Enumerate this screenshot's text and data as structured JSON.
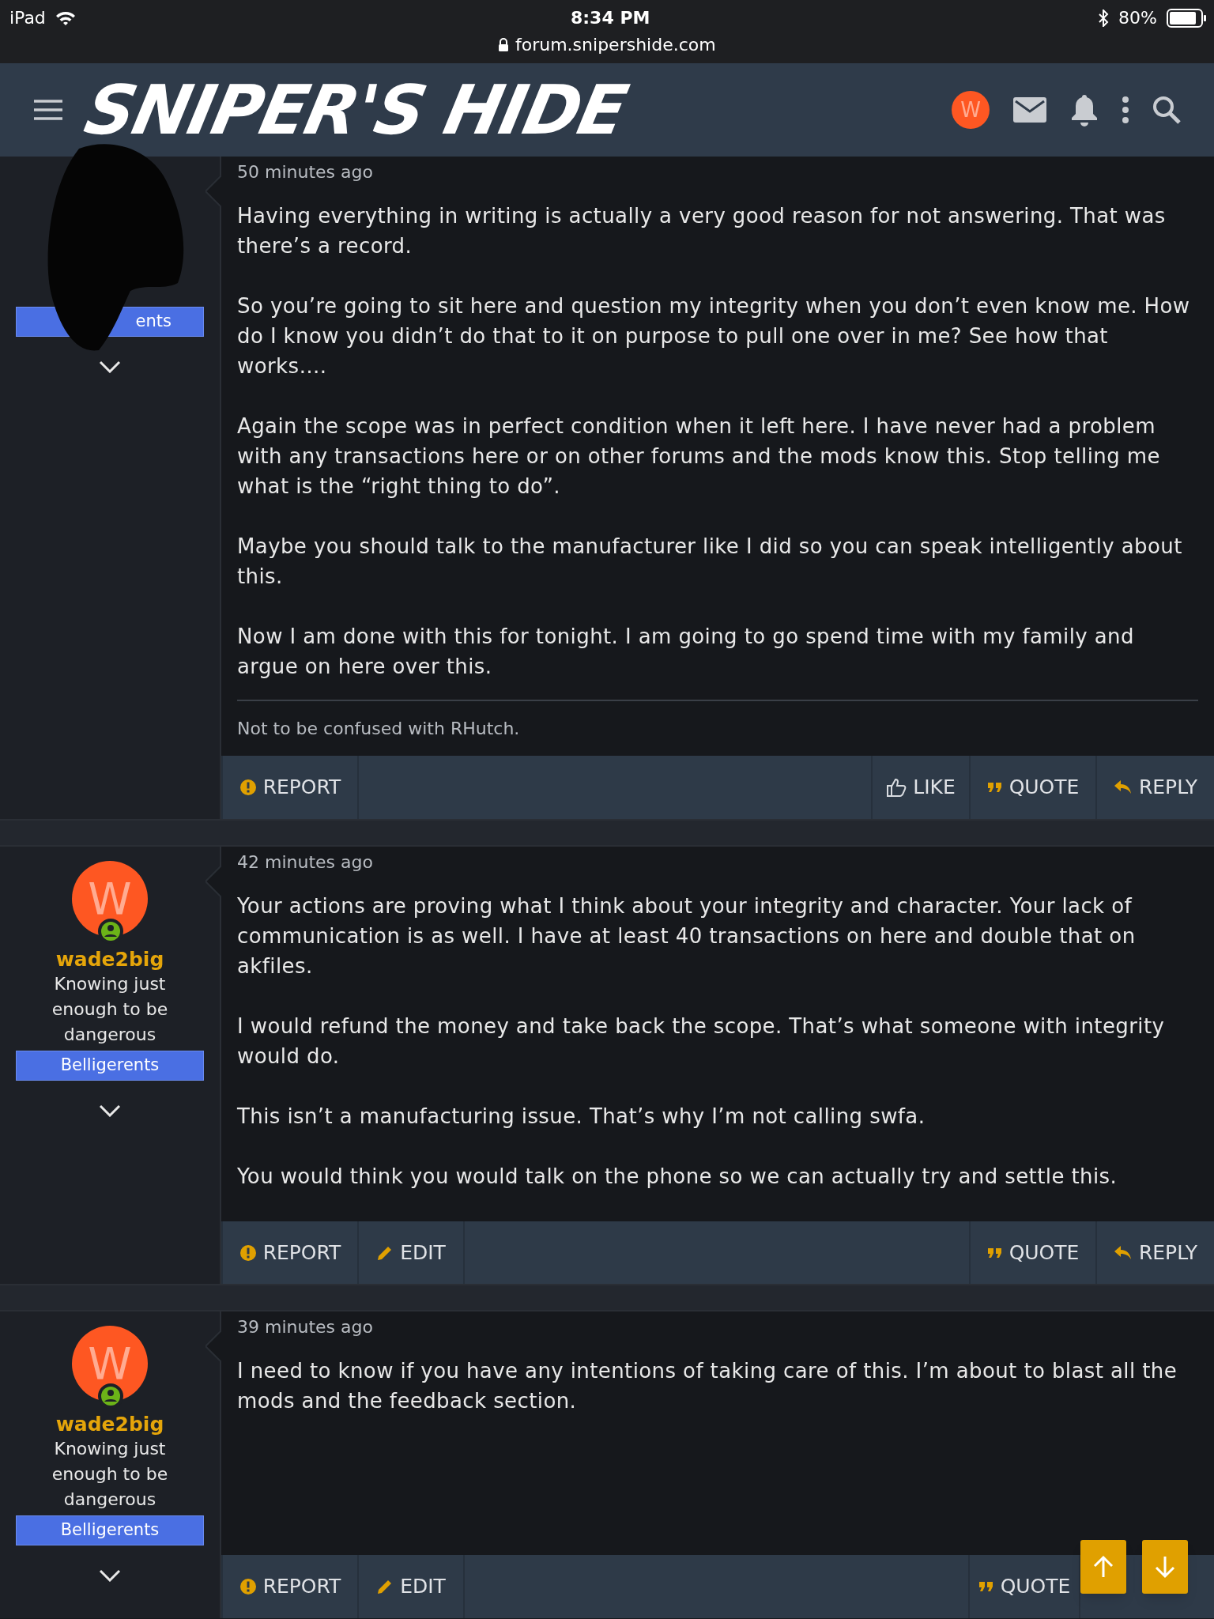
{
  "status_bar": {
    "device": "iPad",
    "time": "8:34 PM",
    "url": "forum.snipershide.com",
    "battery": "80%"
  },
  "nav": {
    "logo": "SNIPER'S HIDE",
    "avatar_letter": "W"
  },
  "posts": [
    {
      "badge": "ents",
      "time": "50 minutes ago",
      "paragraphs": [
        "Having everything in writing is actually a very good reason for not answering. That was there’s a record.",
        "So you’re going to sit here and question my integrity when you don’t even know me. How do I know you didn’t do that to it on purpose to pull one over in me? See how that works….",
        "Again the scope was in perfect condition when it left here. I have never had a problem with any transactions here or on other forums and the mods know this. Stop telling me what is the “right thing to do”.",
        "Maybe you should talk to the manufacturer like I did so you can speak intelligently about this.",
        "Now I am done with this for tonight. I am going to go spend time with my family and argue on here over this."
      ],
      "signature": "Not to be confused with RHutch.",
      "actions": [
        {
          "kind": "report",
          "label": "REPORT"
        },
        {
          "kind": "spacer"
        },
        {
          "kind": "like",
          "label": "LIKE"
        },
        {
          "kind": "quote",
          "label": "QUOTE"
        },
        {
          "kind": "reply",
          "label": "REPLY"
        }
      ]
    },
    {
      "avatar_letter": "W",
      "username": "wade2big",
      "user_title": "Knowing just enough to be dangerous",
      "badge": "Belligerents",
      "time": "42 minutes ago",
      "paragraphs": [
        "Your actions are proving what I think about your integrity and character. Your lack of communication is as well. I have at least 40 transactions on here and double that on akfiles.",
        "I would refund the money and take back the scope. That’s what someone with integrity would do.",
        "This isn’t a manufacturing issue. That’s why I’m not calling swfa.",
        "You would think you would talk on the phone so we can actually try and settle this."
      ],
      "actions": [
        {
          "kind": "report",
          "label": "REPORT"
        },
        {
          "kind": "edit",
          "label": "EDIT"
        },
        {
          "kind": "spacer"
        },
        {
          "kind": "quote",
          "label": "QUOTE"
        },
        {
          "kind": "reply",
          "label": "REPLY"
        }
      ]
    },
    {
      "avatar_letter": "W",
      "username": "wade2big",
      "user_title": "Knowing just enough to be dangerous",
      "badge": "Belligerents",
      "time": "39 minutes ago",
      "paragraphs": [
        "I need to know if you have any intentions of taking care of this. I’m about to blast all the mods and the feedback section."
      ],
      "actions": [
        {
          "kind": "report",
          "label": "REPORT"
        },
        {
          "kind": "edit",
          "label": "EDIT"
        },
        {
          "kind": "spacer"
        },
        {
          "kind": "quote",
          "label": "QUOTE"
        }
      ]
    }
  ]
}
